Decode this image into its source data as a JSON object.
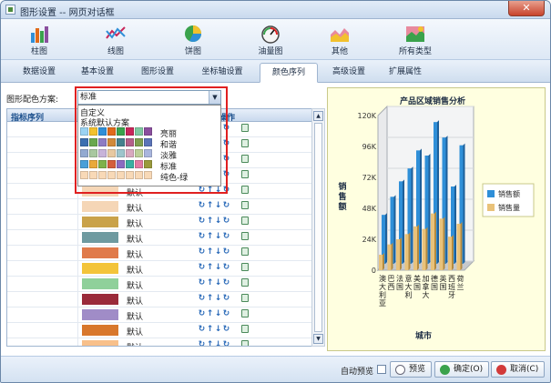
{
  "window": {
    "title": "图形设置 -- 网页对话框",
    "close_glyph": "✕"
  },
  "chart_types": [
    {
      "label": "柱图",
      "icon": "bar-chart-icon",
      "active": true
    },
    {
      "label": "线图",
      "icon": "line-chart-icon",
      "active": false
    },
    {
      "label": "饼图",
      "icon": "pie-chart-icon",
      "active": false
    },
    {
      "label": "油量图",
      "icon": "gauge-chart-icon",
      "active": false
    },
    {
      "label": "其他",
      "icon": "other-chart-icon",
      "active": false
    },
    {
      "label": "所有类型",
      "icon": "all-types-icon",
      "active": false
    }
  ],
  "tabs": [
    {
      "label": "数据设置",
      "active": false
    },
    {
      "label": "基本设置",
      "active": false
    },
    {
      "label": "图形设置",
      "active": false
    },
    {
      "label": "坐标轴设置",
      "active": false
    },
    {
      "label": "颜色序列",
      "active": true
    },
    {
      "label": "高级设置",
      "active": false
    },
    {
      "label": "扩展属性",
      "active": false
    }
  ],
  "scheme": {
    "label": "图形配色方案:",
    "selected": "标准",
    "arrow": "▼"
  },
  "dropdown": {
    "options": [
      "自定义",
      "系统默认方案"
    ],
    "palettes": [
      {
        "name": "亮丽",
        "colors": [
          "#9bd3f2",
          "#f2c12e",
          "#2f8fd8",
          "#e06a1b",
          "#3aa24c",
          "#c8265a",
          "#7fc8a0",
          "#8a4f9e",
          "#5aa02c",
          "#2a5fa8"
        ]
      },
      {
        "name": "和谐",
        "colors": [
          "#3b6fb0",
          "#6aa84f",
          "#8e7cc3",
          "#d28a3a",
          "#45818e",
          "#b45f8a",
          "#7f9f4f",
          "#5b74b8",
          "#a64d79",
          "#6b8e23"
        ]
      },
      {
        "name": "淡雅",
        "colors": [
          "#93aad1",
          "#a8c7a0",
          "#c7b3d9",
          "#e7c9a1",
          "#9ec5cc",
          "#d9a9bf",
          "#bccf99",
          "#a9b6dd",
          "#cfa3bc",
          "#b5c98e"
        ]
      },
      {
        "name": "标准",
        "colors": [
          "#4a9fd8",
          "#e9a93a",
          "#7fb24a",
          "#d45e3c",
          "#8b6cc1",
          "#3ab0a2",
          "#e27ba3",
          "#9a9a3c",
          "#5d7fc9",
          "#f0c419"
        ]
      },
      {
        "name": "纯色-绿",
        "colors": [
          "#f8d9b7",
          "#f8d9b7",
          "#f8d9b7",
          "#f8d9b7",
          "#f8d9b7",
          "#f8d9b7",
          "#f8d9b7",
          "#f8d9b7",
          "#f8d9b7",
          "#f8d9b7"
        ]
      }
    ]
  },
  "grid": {
    "headers": {
      "series": "指标序列",
      "ops": "操作"
    },
    "default_label": "默认",
    "op_glyphs": [
      "↻",
      "↑",
      "↓",
      "↻"
    ],
    "rows": [
      {
        "color": "#f5d6b6"
      },
      {
        "color": "#f5d6b6"
      },
      {
        "color": "#f5d6b6"
      },
      {
        "color": "#f5d6b6"
      },
      {
        "color": "#f5d6b6"
      },
      {
        "color": "#f5d6b6"
      },
      {
        "color": "#c9a24a"
      },
      {
        "color": "#6e9aa0"
      },
      {
        "color": "#e07a4a"
      },
      {
        "color": "#f3c43a"
      },
      {
        "color": "#8fd09a"
      },
      {
        "color": "#9a2a3a"
      },
      {
        "color": "#a08cc7"
      },
      {
        "color": "#d8772c"
      },
      {
        "color": "#f8c08a"
      },
      {
        "color": "#b39a2e"
      }
    ]
  },
  "chart_data": {
    "type": "bar",
    "title": "产品区域销售分析",
    "xlabel": "城市",
    "ylabel": "销售额",
    "categories": [
      "澳大利亚",
      "巴西",
      "法国",
      "意大利",
      "美国",
      "加拿大",
      "德国",
      "英国",
      "西班牙",
      "荷兰"
    ],
    "ytick_labels": [
      "0",
      "24K",
      "48K",
      "72K",
      "96K",
      "120K"
    ],
    "ylim": [
      0,
      120000
    ],
    "grid": true,
    "legend_position": "right",
    "series": [
      {
        "name": "销售额",
        "color": "#2f8fd8",
        "values": [
          38000,
          52000,
          64000,
          74000,
          88000,
          84000,
          110000,
          98000,
          60000,
          92000
        ]
      },
      {
        "name": "销售量",
        "color": "#e9c27a",
        "values": [
          12000,
          20000,
          24000,
          28000,
          34000,
          32000,
          44000,
          40000,
          26000,
          36000
        ]
      }
    ]
  },
  "bottom": {
    "auto_preview_label": "自动预览",
    "preview_label": "预览",
    "ok_label": "确定(O)",
    "cancel_label": "取消(C)"
  }
}
